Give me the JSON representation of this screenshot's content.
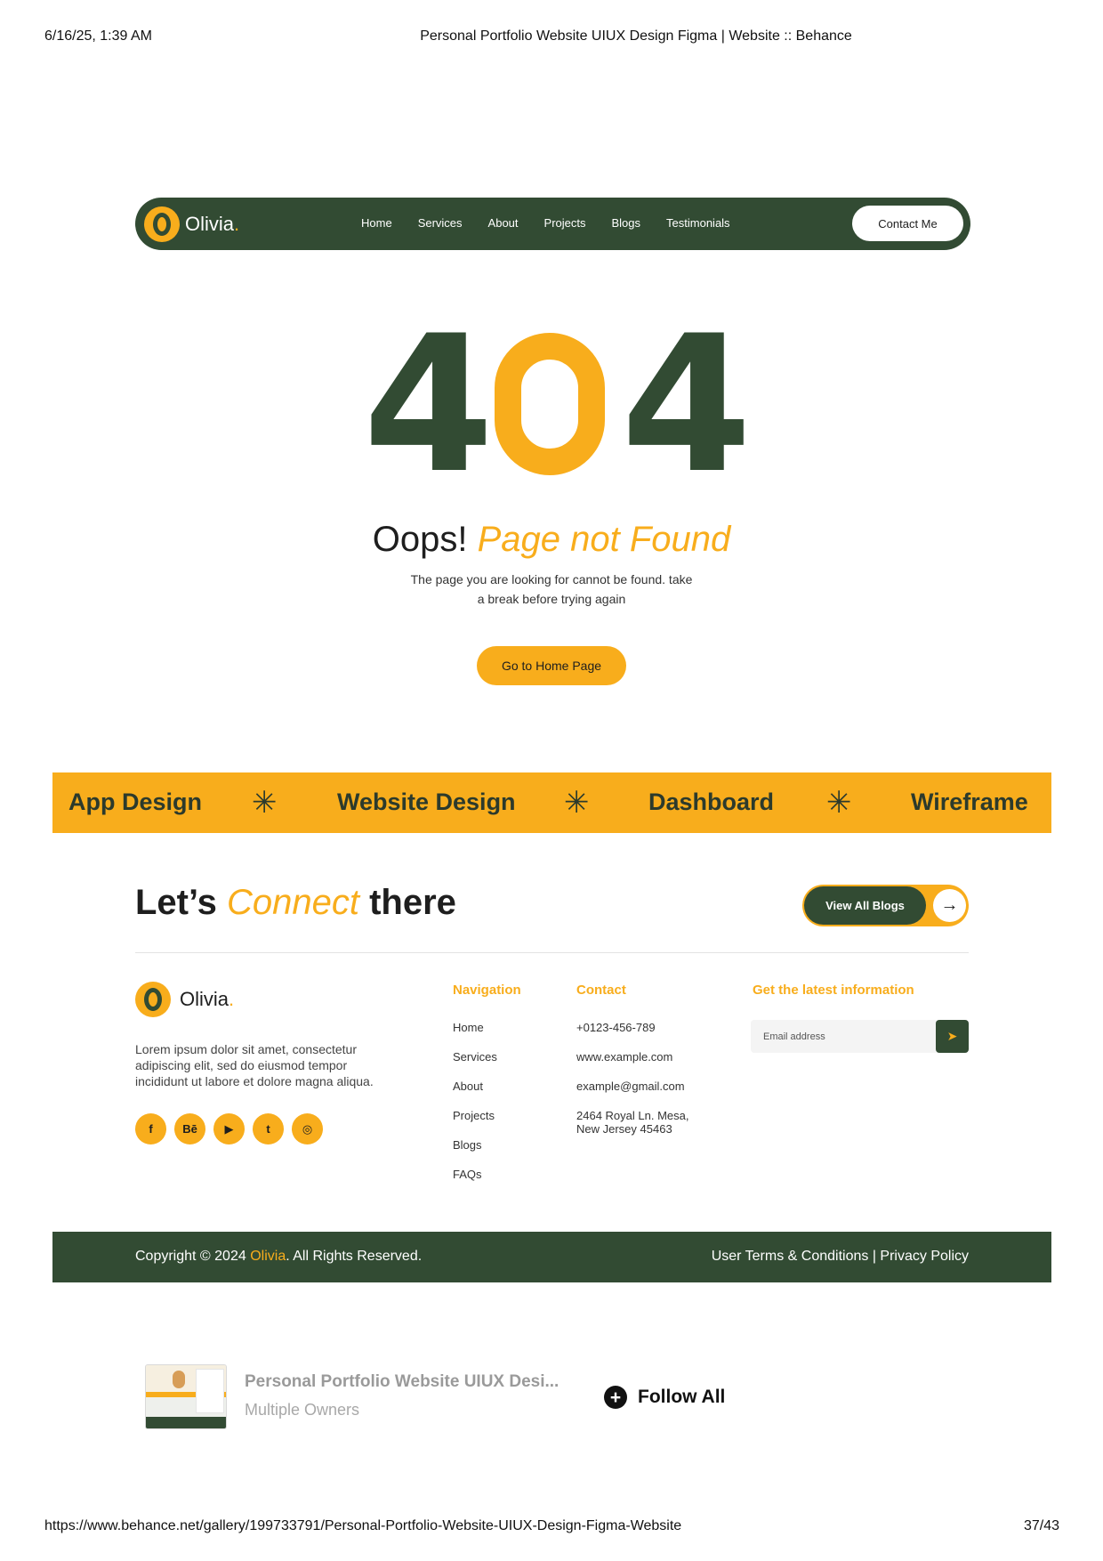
{
  "print_header": {
    "date": "6/16/25, 1:39 AM",
    "title": "Personal Portfolio Website UIUX Design Figma | Website :: Behance"
  },
  "navbar": {
    "logo_letter": "O",
    "brand": "Olivia",
    "brand_dot": ".",
    "links": [
      "Home",
      "Services",
      "About",
      "Projects",
      "Blogs",
      "Testimonials"
    ],
    "contact": "Contact Me"
  },
  "error": {
    "digit_left": "4",
    "digit_right": "4",
    "title_plain": "Oops!",
    "title_accent": "Page not Found",
    "description": "The page you are looking for cannot be found. take a break before trying again",
    "button": "Go to Home Page"
  },
  "band": {
    "items": [
      "App Design",
      "Website Design",
      "Dashboard",
      "Wireframe"
    ],
    "separator": "✳"
  },
  "connect": {
    "part1": "Let’s",
    "accent": "Connect",
    "part2": "there",
    "button": "View All Blogs",
    "arrow": "→"
  },
  "footer": {
    "logo_letter": "O",
    "brand": "Olivia",
    "brand_dot": ".",
    "about": "Lorem ipsum dolor sit amet, consectetur adipiscing elit, sed do eiusmod tempor incididunt ut labore et dolore magna aliqua.",
    "socials": [
      {
        "icon": "facebook-icon",
        "glyph": "f"
      },
      {
        "icon": "behance-icon",
        "glyph": "Bē"
      },
      {
        "icon": "youtube-icon",
        "glyph": "▶"
      },
      {
        "icon": "twitter-icon",
        "glyph": "t"
      },
      {
        "icon": "instagram-icon",
        "glyph": "◎"
      }
    ],
    "navigation": {
      "heading": "Navigation",
      "links": [
        "Home",
        "Services",
        "About",
        "Projects",
        "Blogs",
        "FAQs"
      ]
    },
    "contact": {
      "heading": "Contact",
      "phone": "+0123-456-789",
      "website": "www.example.com",
      "email": "example@gmail.com",
      "address_line1": "2464 Royal Ln. Mesa,",
      "address_line2": "New Jersey 45463"
    },
    "newsletter": {
      "heading": "Get the latest information",
      "placeholder": "Email address",
      "send_glyph": "➤"
    }
  },
  "copyright": {
    "prefix": "Copyright © 2024",
    "brand": "Olivia",
    "suffix": ". All Rights Reserved.",
    "terms": "User Terms & Conditions",
    "divider": "|",
    "privacy": "Privacy Policy"
  },
  "owner_strip": {
    "title": "Personal Portfolio Website UIUX Desi...",
    "subtitle": "Multiple Owners",
    "follow_glyph": "+",
    "follow": "Follow All"
  },
  "print_footer": {
    "url": "https://www.behance.net/gallery/199733791/Personal-Portfolio-Website-UIUX-Design-Figma-Website",
    "page": "37/43"
  },
  "colors": {
    "accent": "#f8ad1c",
    "dark_green": "#324b33"
  }
}
